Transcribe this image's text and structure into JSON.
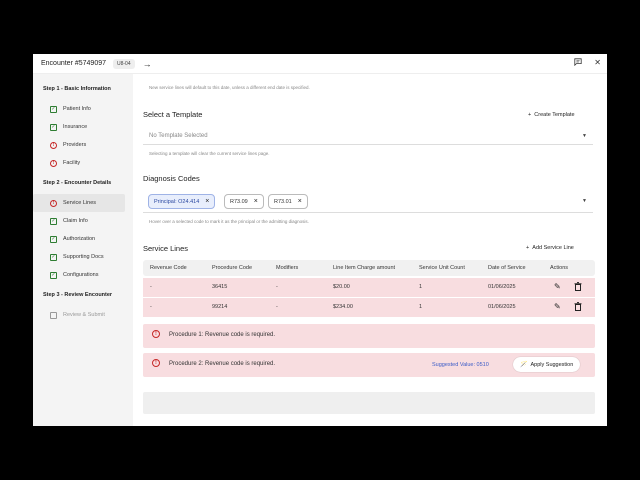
{
  "header": {
    "title": "Encounter #5749097",
    "badge": "U8-04",
    "arrow_icon": "arrow-right-icon",
    "chat_icon": "chat-icon",
    "close_icon": "close-icon"
  },
  "sidebar": {
    "step1": {
      "label": "Step 1 - Basic Information",
      "items": [
        {
          "label": "Patient Info",
          "status": "check"
        },
        {
          "label": "Insurance",
          "status": "check"
        },
        {
          "label": "Providers",
          "status": "error"
        },
        {
          "label": "Facility",
          "status": "error"
        }
      ]
    },
    "step2": {
      "label": "Step 2 - Encounter Details",
      "items": [
        {
          "label": "Service Lines",
          "status": "error",
          "active": true
        },
        {
          "label": "Claim Info",
          "status": "check"
        },
        {
          "label": "Authorization",
          "status": "check"
        },
        {
          "label": "Supporting Docs",
          "status": "check"
        },
        {
          "label": "Configurations",
          "status": "check"
        }
      ]
    },
    "step3": {
      "label": "Step 3 - Review Encounter",
      "items": [
        {
          "label": "Review & Submit",
          "status": "empty",
          "disabled": true
        }
      ]
    }
  },
  "main": {
    "service_date_hint": "New service lines will default to this date, unless a different end date is specified.",
    "template": {
      "title": "Select a Template",
      "create_label": "Create Template",
      "placeholder": "No Template Selected",
      "hint": "Selecting a template will clear the current service lines page."
    },
    "diagnosis": {
      "title": "Diagnosis Codes",
      "codes": [
        "Principal: O24.414",
        "R73.09",
        "R73.01"
      ],
      "hint": "Hover over a selected code to mark it as the principal or the admitting diagnosis."
    },
    "service_lines": {
      "title": "Service Lines",
      "add_label": "Add Service Line",
      "columns": [
        "Revenue Code",
        "Procedure Code",
        "Modifiers",
        "Line Item Charge amount",
        "Service Unit Count",
        "Date of Service",
        "Actions"
      ],
      "rows": [
        [
          "-",
          "36415",
          "-",
          "$20.00",
          "1",
          "01/06/2025"
        ],
        [
          "-",
          "99214",
          "-",
          "$234.00",
          "1",
          "01/06/2025"
        ]
      ]
    },
    "alerts": [
      {
        "text": "Procedure 1: Revenue code is required."
      },
      {
        "text": "Procedure 2: Revenue code is required.",
        "suggestion": "Suggested Value: 0510",
        "apply_label": "Apply Suggestion"
      }
    ]
  }
}
